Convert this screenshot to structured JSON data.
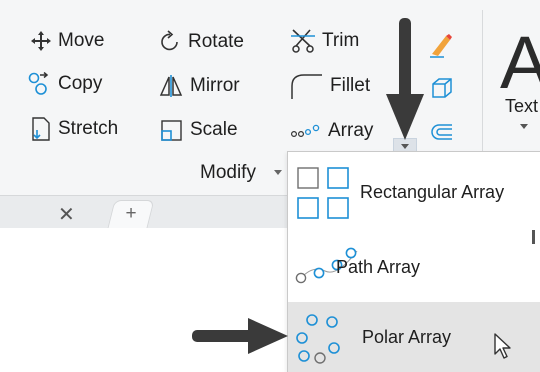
{
  "ribbon": {
    "tools": [
      {
        "name": "move-button",
        "label": "Move",
        "icon": "move-icon"
      },
      {
        "name": "copy-button",
        "label": "Copy",
        "icon": "copy-icon"
      },
      {
        "name": "stretch-button",
        "label": "Stretch",
        "icon": "stretch-icon"
      },
      {
        "name": "rotate-button",
        "label": "Rotate",
        "icon": "rotate-icon"
      },
      {
        "name": "mirror-button",
        "label": "Mirror",
        "icon": "mirror-icon"
      },
      {
        "name": "scale-button",
        "label": "Scale",
        "icon": "scale-icon"
      },
      {
        "name": "trim-button",
        "label": "Trim",
        "icon": "trim-icon"
      },
      {
        "name": "fillet-button",
        "label": "Fillet",
        "icon": "fillet-icon"
      },
      {
        "name": "array-button",
        "label": "Array",
        "icon": "array-icon"
      }
    ],
    "panel_title": "Modify",
    "text_panel_glyph": "A",
    "text_panel_label": "Text"
  },
  "tabs": {
    "close_glyph": "✕",
    "add_glyph": "+"
  },
  "array_dropdown": {
    "items": [
      {
        "label": "Rectangular Array",
        "icon": "rectangular-array-icon"
      },
      {
        "label": "Path Array",
        "icon": "path-array-icon"
      },
      {
        "label": "Polar Array",
        "icon": "polar-array-icon",
        "highlighted": true
      }
    ]
  },
  "colors": {
    "ribbon_bg": "#f5f6f7",
    "icon_blue": "#1e90d6",
    "hover_bg": "#e4e4e4",
    "annotation_arrow": "#3a3a3a"
  }
}
